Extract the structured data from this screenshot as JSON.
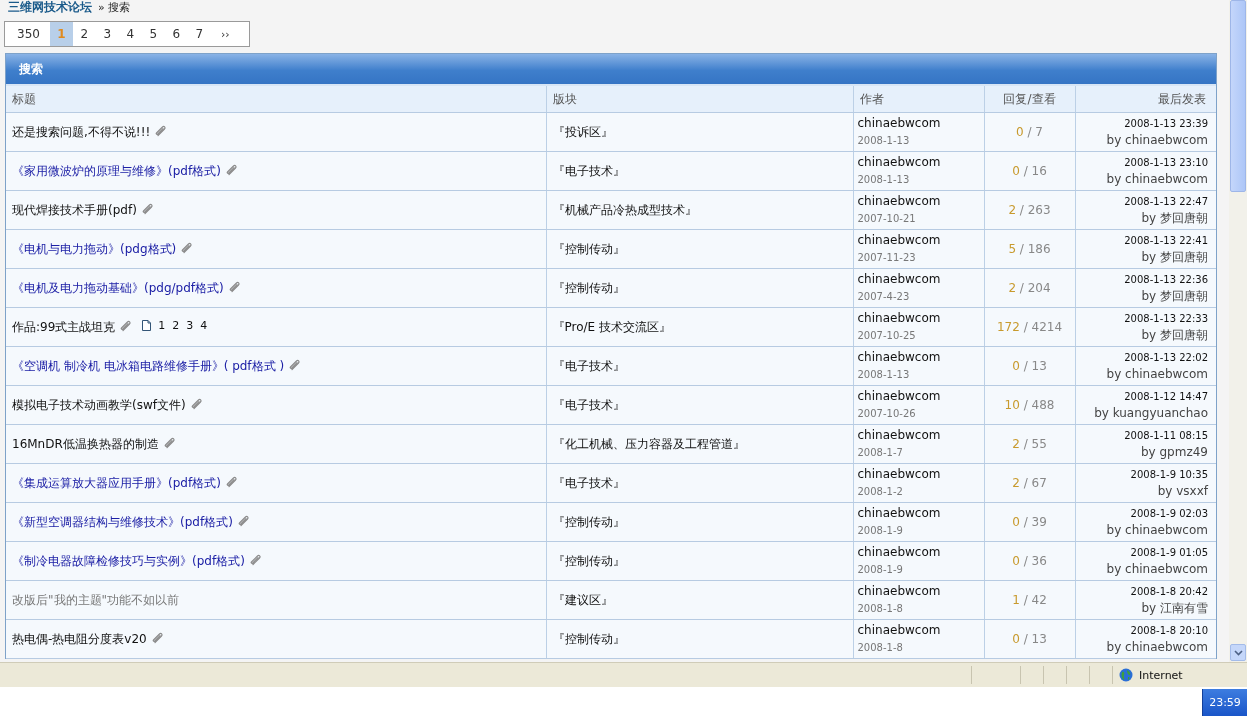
{
  "breadcrumb": {
    "forum": "三维网技术论坛",
    "current": "» 搜索"
  },
  "pager": {
    "total": "350",
    "pages": [
      {
        "label": "1",
        "selected": true
      },
      {
        "label": "2",
        "selected": false
      },
      {
        "label": "3",
        "selected": false
      },
      {
        "label": "4",
        "selected": false
      },
      {
        "label": "5",
        "selected": false
      },
      {
        "label": "6",
        "selected": false
      },
      {
        "label": "7",
        "selected": false
      }
    ],
    "next": "››"
  },
  "panel": {
    "title": "搜索"
  },
  "table": {
    "columns": [
      "标题",
      "版块",
      "作者",
      "回复/查看",
      "最后发表"
    ],
    "rows": [
      {
        "title": "还是搜索问题,不得不说!!!",
        "kind": "normal",
        "attachment": true,
        "board": "『投诉区』",
        "author": "chinaebwcom",
        "date": "2008-1-13",
        "replies": "0",
        "views": "/ 7",
        "last_time": "2008-1-13 23:39",
        "last_by": "by chinaebwcom"
      },
      {
        "title": "《家用微波炉的原理与维修》(pdf格式)",
        "kind": "link",
        "attachment": true,
        "board": "『电子技术』",
        "author": "chinaebwcom",
        "date": "2008-1-13",
        "replies": "0",
        "views": "/ 16",
        "last_time": "2008-1-13 23:10",
        "last_by": "by chinaebwcom"
      },
      {
        "title": "现代焊接技术手册(pdf)",
        "kind": "normal",
        "attachment": true,
        "board": "『机械产品冷热成型技术』",
        "author": "chinaebwcom",
        "date": "2007-10-21",
        "replies": "2",
        "views": "/ 263",
        "last_time": "2008-1-13 22:47",
        "last_by": "by 梦回唐朝"
      },
      {
        "title": "《电机与电力拖动》(pdg格式)",
        "kind": "link",
        "attachment": true,
        "board": "『控制传动』",
        "author": "chinaebwcom",
        "date": "2007-11-23",
        "replies": "5",
        "views": "/ 186",
        "last_time": "2008-1-13 22:41",
        "last_by": "by 梦回唐朝"
      },
      {
        "title": "《电机及电力拖动基础》(pdg/pdf格式)",
        "kind": "link",
        "attachment": true,
        "board": "『控制传动』",
        "author": "chinaebwcom",
        "date": "2007-4-23",
        "replies": "2",
        "views": "/ 204",
        "last_time": "2008-1-13 22:36",
        "last_by": "by 梦回唐朝"
      },
      {
        "title": "作品:99式主战坦克",
        "kind": "normal",
        "attachment": true,
        "pages": [
          "1",
          "2",
          "3",
          "4"
        ],
        "board": "『Pro/E 技术交流区』",
        "author": "chinaebwcom",
        "date": "2007-10-25",
        "replies": "172",
        "views": "/ 4214",
        "last_time": "2008-1-13 22:33",
        "last_by": "by 梦回唐朝"
      },
      {
        "title": "《空调机  制冷机  电冰箱电路维修手册》( pdf格式 )",
        "kind": "link",
        "attachment": true,
        "board": "『电子技术』",
        "author": "chinaebwcom",
        "date": "2008-1-13",
        "replies": "0",
        "views": "/ 13",
        "last_time": "2008-1-13 22:02",
        "last_by": "by chinaebwcom"
      },
      {
        "title": "模拟电子技术动画教学(swf文件)",
        "kind": "normal",
        "attachment": true,
        "board": "『电子技术』",
        "author": "chinaebwcom",
        "date": "2007-10-26",
        "replies": "10",
        "views": "/ 488",
        "last_time": "2008-1-12 14:47",
        "last_by": "by kuangyuanchao"
      },
      {
        "title": "16MnDR低温换热器的制造",
        "kind": "normal",
        "attachment": true,
        "board": "『化工机械、压力容器及工程管道』",
        "author": "chinaebwcom",
        "date": "2008-1-7",
        "replies": "2",
        "views": "/ 55",
        "last_time": "2008-1-11 08:15",
        "last_by": "by gpmz49"
      },
      {
        "title": "《集成运算放大器应用手册》(pdf格式)",
        "kind": "link",
        "attachment": true,
        "board": "『电子技术』",
        "author": "chinaebwcom",
        "date": "2008-1-2",
        "replies": "2",
        "views": "/ 67",
        "last_time": "2008-1-9 10:35",
        "last_by": "by vsxxf"
      },
      {
        "title": "《新型空调器结构与维修技术》(pdf格式)",
        "kind": "link",
        "attachment": true,
        "board": "『控制传动』",
        "author": "chinaebwcom",
        "date": "2008-1-9",
        "replies": "0",
        "views": "/ 39",
        "last_time": "2008-1-9 02:03",
        "last_by": "by chinaebwcom"
      },
      {
        "title": "《制冷电器故障检修技巧与实例》(pdf格式)",
        "kind": "link",
        "attachment": true,
        "board": "『控制传动』",
        "author": "chinaebwcom",
        "date": "2008-1-9",
        "replies": "0",
        "views": "/ 36",
        "last_time": "2008-1-9 01:05",
        "last_by": "by chinaebwcom"
      },
      {
        "title": "改版后\"我的主题\"功能不如以前",
        "kind": "muted",
        "attachment": false,
        "board": "『建议区』",
        "author": "chinaebwcom",
        "date": "2008-1-8",
        "replies": "1",
        "views": "/ 42",
        "last_time": "2008-1-8 20:42",
        "last_by": "by 江南有雪"
      },
      {
        "title": "热电偶-热电阻分度表v20",
        "kind": "normal",
        "attachment": true,
        "board": "『控制传动』",
        "author": "chinaebwcom",
        "date": "2008-1-8",
        "replies": "0",
        "views": "/ 13",
        "last_time": "2008-1-8 20:10",
        "last_by": "by chinaebwcom"
      }
    ]
  },
  "status_bar": {
    "zone": "Internet"
  },
  "taskbar": {
    "clock": "23:59"
  }
}
